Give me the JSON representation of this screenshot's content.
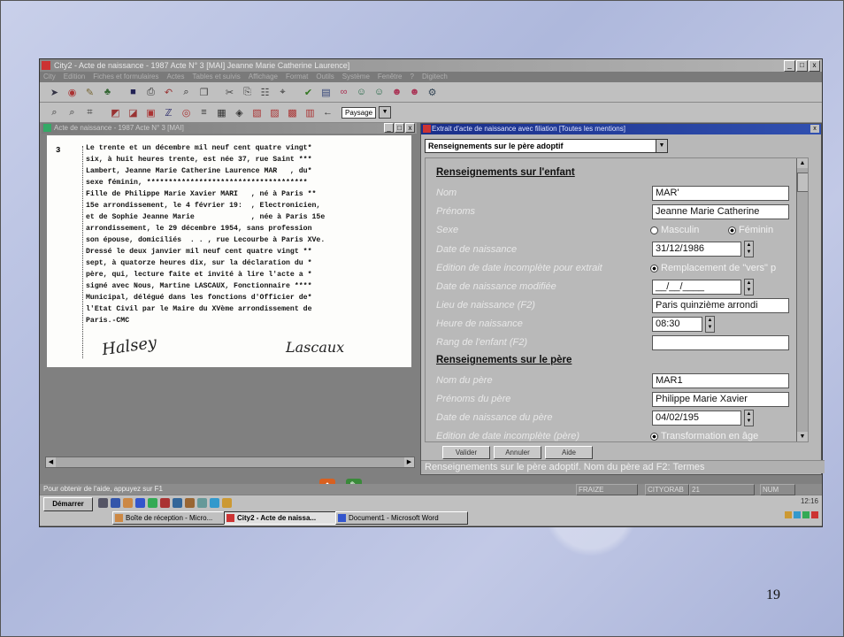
{
  "slide": {
    "page_number": "19"
  },
  "app": {
    "title": "City2 - Acte de naissance - 1987 Acte N° 3 [MAI]   Jeanne Marie Catherine Laurence]",
    "menu": [
      "City",
      "Edition",
      "Fiches et formulaires",
      "Actes",
      "Tables et suivis",
      "Affichage",
      "Format",
      "Outils",
      "Système",
      "Fenêtre",
      "?",
      "Digitech"
    ],
    "orientation_select": "Paysage",
    "window_buttons": [
      "_",
      "□",
      "x"
    ]
  },
  "left_window": {
    "title": "Acte de naissance - 1987 Acte N° 3 [MAI]",
    "act_number": "3",
    "document_lines": [
      "Le trente et un décembre mil neuf cent quatre vingt*",
      "six, à huit heures trente, est née 37, rue Saint ***",
      "Lambert, Jeanne Marie Catherine Laurence MAR   , du*",
      "sexe féminin, *************************************",
      "Fille de Philippe Marie Xavier MARI   , né à Paris **",
      "15e arrondissement, le 4 février 19:  , Electronicien,",
      "et de Sophie Jeanne Marie             , née à Paris 15e",
      "arrondissement, le 29 décembre 1954, sans profession",
      "son épouse, domiciliés  . . , rue Lecourbe à Paris XVe.",
      "Dressé le deux janvier mil neuf cent quatre vingt **",
      "sept, à quatorze heures dix, sur la déclaration du *",
      "père, qui, lecture faite et invité à lire l'acte a *",
      "signé avec Nous, Martine LASCAUX, Fonctionnaire ****",
      "Municipal, délégué dans les fonctions d'Officier de*",
      "l'Etat Civil par le Maire du XVème arrondissement de",
      "Paris.-CMC"
    ],
    "signature_left": "Halsey",
    "signature_right": "Lascaux"
  },
  "right_window": {
    "title": "Extrait d'acte de naissance avec filiation [Toutes les mentions]",
    "section_select": "Renseignements sur le père adoptif",
    "section_enfant": "Renseignements sur l'enfant",
    "section_pere": "Renseignements sur le père",
    "fields": {
      "nom": {
        "label": "Nom",
        "value": "MAR'"
      },
      "prenoms": {
        "label": "Prénoms",
        "value": "Jeanne Marie Catherine"
      },
      "sexe": {
        "label": "Sexe",
        "opt1": "Masculin",
        "opt2": "Féminin"
      },
      "date_naissance": {
        "label": "Date de naissance",
        "value": "31/12/1986"
      },
      "edition_date": {
        "label": "Edition de date incomplète pour extrait",
        "option": "Remplacement de \"vers\" p"
      },
      "date_modifiee": {
        "label": "Date de naissance modifiée",
        "value": "__/__/____"
      },
      "lieu": {
        "label": "Lieu de naissance (F2)",
        "value": "Paris quinzième arrondi"
      },
      "heure": {
        "label": "Heure de naissance",
        "value": "08:30"
      },
      "rang": {
        "label": "Rang de l'enfant (F2)",
        "value": ""
      },
      "nom_pere": {
        "label": "Nom du père",
        "value": "MAR1"
      },
      "prenoms_pere": {
        "label": "Prénoms du père",
        "value": "Philippe Marie Xavier"
      },
      "date_pere": {
        "label": "Date de naissance du père",
        "value": "04/02/195"
      },
      "edition_pere": {
        "label": "Edition de date incomplète (père)",
        "option": "Transformation en âge"
      }
    },
    "buttons": {
      "valider": "Valider",
      "annuler": "Annuler",
      "aide": "Aide"
    },
    "status": "Renseignements sur le père adoptif. Nom du père ad F2: Termes"
  },
  "statusbar": {
    "hint": "Pour obtenir de l'aide, appuyez sur F1",
    "cells": [
      "FRAIZE",
      "CITYORAB",
      "21",
      "NUM"
    ]
  },
  "taskbar": {
    "start": "Démarrer",
    "tasks": [
      "Boîte de réception - Micro...",
      "City2 - Acte de naissa...",
      "Document1 - Microsoft Word"
    ],
    "clock": "12:16"
  },
  "colors": {
    "title_active": "#1a2f8a",
    "title_inactive": "#8a8a8a",
    "desktop": "#aeb8dc"
  }
}
